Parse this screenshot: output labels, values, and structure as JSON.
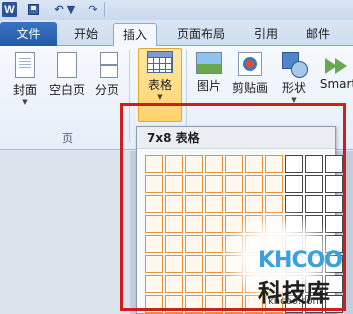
{
  "quick_access": {
    "app_logo": "W",
    "icons": [
      "word-logo-icon",
      "save-icon",
      "undo-icon",
      "redo-icon"
    ]
  },
  "tabs": [
    {
      "label": "文件",
      "active": false,
      "accent": "#2b5fae"
    },
    {
      "label": "开始",
      "active": false
    },
    {
      "label": "插入",
      "active": true
    },
    {
      "label": "页面布局",
      "active": false
    },
    {
      "label": "引用",
      "active": false
    },
    {
      "label": "邮件",
      "active": false
    }
  ],
  "ribbon": {
    "pages_group": {
      "label": "页",
      "buttons": [
        {
          "label": "封面",
          "icon": "cover-page-icon"
        },
        {
          "label": "空白页",
          "icon": "blank-page-icon"
        },
        {
          "label": "分页",
          "icon": "page-break-icon"
        }
      ]
    },
    "table_button": {
      "label": "表格",
      "icon": "table-icon",
      "highlight": "#ffd36a"
    },
    "illustrations": [
      {
        "label": "图片",
        "icon": "picture-icon"
      },
      {
        "label": "剪贴画",
        "icon": "clip-art-icon"
      },
      {
        "label": "形状",
        "icon": "shapes-icon"
      },
      {
        "label": "Smart",
        "icon": "smartart-icon"
      }
    ]
  },
  "table_dropdown": {
    "header": "7x8 表格",
    "grid_columns": 10,
    "grid_rows": 8,
    "selected_columns": 7,
    "selected_rows": 8,
    "selected_color": "#e8913a"
  },
  "annotation": {
    "frame_color": "#cf1e1e"
  },
  "watermark": {
    "logo": "KHCOO",
    "name": "科技库",
    "url": "khcoo.com"
  }
}
